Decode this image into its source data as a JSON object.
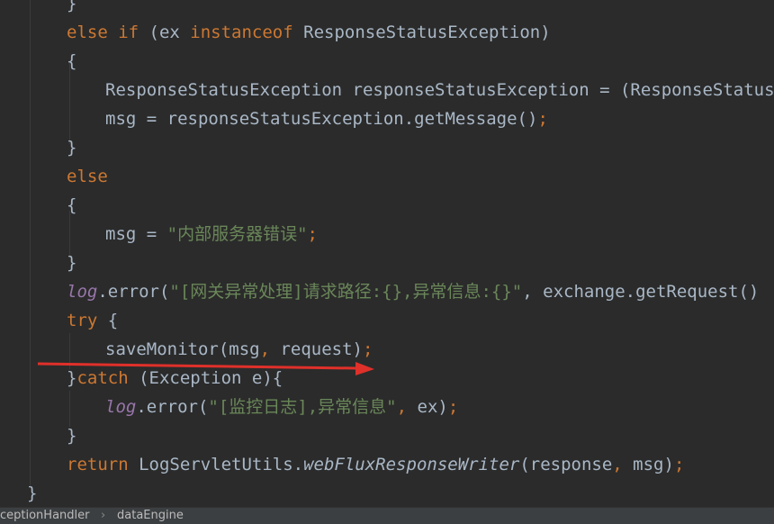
{
  "editor": {
    "lines": [
      {
        "id": "l0",
        "indent": 1,
        "tokens": [
          {
            "t": "}",
            "c": "plain"
          }
        ]
      },
      {
        "id": "l1",
        "indent": 1,
        "tokens": [
          {
            "t": "else if ",
            "c": "kw"
          },
          {
            "t": "(ex ",
            "c": "plain"
          },
          {
            "t": "instanceof ",
            "c": "kw"
          },
          {
            "t": "ResponseStatusException)",
            "c": "plain"
          }
        ]
      },
      {
        "id": "l2",
        "indent": 1,
        "tokens": [
          {
            "t": "{",
            "c": "plain"
          }
        ]
      },
      {
        "id": "l3",
        "indent": 2,
        "tokens": [
          {
            "t": "ResponseStatusException responseStatusException = (ResponseStatusExc",
            "c": "plain"
          }
        ]
      },
      {
        "id": "l4",
        "indent": 2,
        "tokens": [
          {
            "t": "msg = responseStatusException.getMessage()",
            "c": "plain"
          },
          {
            "t": ";",
            "c": "kw"
          }
        ]
      },
      {
        "id": "l5",
        "indent": 1,
        "tokens": [
          {
            "t": "}",
            "c": "plain"
          }
        ]
      },
      {
        "id": "l6",
        "indent": 1,
        "tokens": [
          {
            "t": "else",
            "c": "kw"
          }
        ]
      },
      {
        "id": "l7",
        "indent": 1,
        "tokens": [
          {
            "t": "{",
            "c": "plain"
          }
        ]
      },
      {
        "id": "l8",
        "indent": 2,
        "tokens": [
          {
            "t": "msg = ",
            "c": "plain"
          },
          {
            "t": "\"内部服务器错误\"",
            "c": "str"
          },
          {
            "t": ";",
            "c": "kw"
          }
        ]
      },
      {
        "id": "l9",
        "indent": 1,
        "tokens": [
          {
            "t": "}",
            "c": "plain"
          }
        ]
      },
      {
        "id": "l10",
        "indent": 1,
        "tokens": [
          {
            "t": "log",
            "c": "field"
          },
          {
            "t": ".error(",
            "c": "plain"
          },
          {
            "t": "\"[网关异常处理]请求路径:{},异常信息:{}\"",
            "c": "str"
          },
          {
            "t": ", exchange.getRequest()",
            "c": "plain"
          }
        ]
      },
      {
        "id": "l11",
        "indent": 1,
        "tokens": [
          {
            "t": "try ",
            "c": "kw"
          },
          {
            "t": "{",
            "c": "plain"
          }
        ]
      },
      {
        "id": "l12",
        "indent": 2,
        "tokens": [
          {
            "t": "saveMonitor(msg",
            "c": "plain"
          },
          {
            "t": ", ",
            "c": "kw"
          },
          {
            "t": "request)",
            "c": "plain"
          },
          {
            "t": ";",
            "c": "kw"
          }
        ]
      },
      {
        "id": "l13",
        "indent": 1,
        "tokens": [
          {
            "t": "}",
            "c": "plain"
          },
          {
            "t": "catch ",
            "c": "kw"
          },
          {
            "t": "(Exception e){",
            "c": "plain"
          }
        ]
      },
      {
        "id": "l14",
        "indent": 2,
        "tokens": [
          {
            "t": "log",
            "c": "field"
          },
          {
            "t": ".error(",
            "c": "plain"
          },
          {
            "t": "\"[监控日志],异常信息\"",
            "c": "str"
          },
          {
            "t": ", ",
            "c": "kw"
          },
          {
            "t": "ex)",
            "c": "plain"
          },
          {
            "t": ";",
            "c": "kw"
          }
        ]
      },
      {
        "id": "l15",
        "indent": 1,
        "tokens": [
          {
            "t": "}",
            "c": "plain"
          }
        ]
      },
      {
        "id": "l16",
        "indent": 1,
        "tokens": [
          {
            "t": "return ",
            "c": "kw"
          },
          {
            "t": "LogServletUtils.",
            "c": "plain"
          },
          {
            "t": "webFluxResponseWriter",
            "c": "italic"
          },
          {
            "t": "(response",
            "c": "plain"
          },
          {
            "t": ", ",
            "c": "kw"
          },
          {
            "t": "msg)",
            "c": "plain"
          },
          {
            "t": ";",
            "c": "kw"
          }
        ]
      },
      {
        "id": "l17",
        "indent": 0,
        "tokens": [
          {
            "t": "}",
            "c": "plain"
          }
        ]
      }
    ]
  },
  "breadcrumb": {
    "items": [
      "ceptionHandler",
      "dataEngine"
    ],
    "separator": "›"
  },
  "annotation": {
    "type": "red-arrow",
    "color": "#e0302a"
  },
  "colors": {
    "background": "#2b2b2b",
    "keyword": "#cc7832",
    "string": "#6a8759",
    "plain": "#a9b7c6",
    "field": "#9876aa"
  }
}
